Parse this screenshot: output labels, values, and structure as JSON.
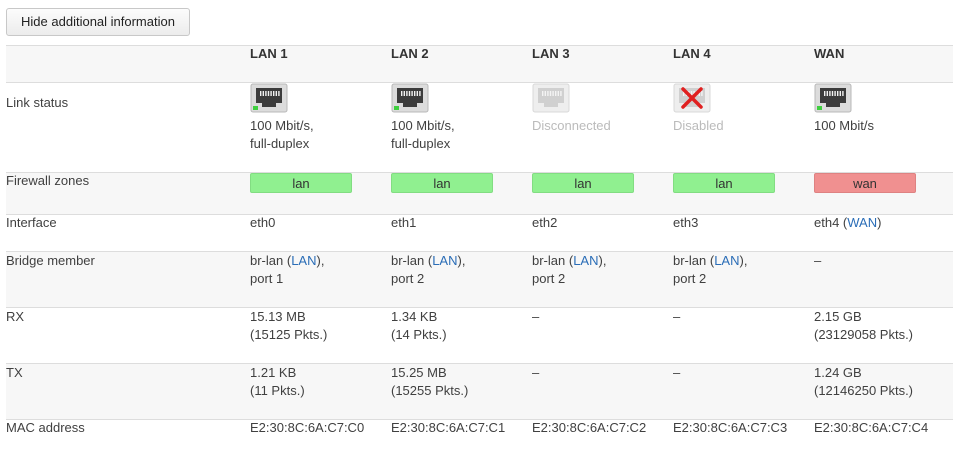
{
  "toggle_label": "Hide additional information",
  "ports": [
    {
      "name": "LAN 1",
      "link_state": "up",
      "link_line1": "100 Mbit/s,",
      "link_line2": "full-duplex",
      "zone": "lan",
      "iface": "eth0",
      "iface_suffix_pre": "",
      "iface_link": "",
      "iface_suffix_post": "",
      "bridge_pre": "br-lan (",
      "bridge_link": "LAN",
      "bridge_post": "),",
      "bridge_port": "port 1",
      "rx_1": "15.13 MB",
      "rx_2": "(15125 Pkts.)",
      "tx_1": "1.21 KB",
      "tx_2": "(11 Pkts.)",
      "mac": "E2:30:8C:6A:C7:C0"
    },
    {
      "name": "LAN 2",
      "link_state": "up",
      "link_line1": "100 Mbit/s,",
      "link_line2": "full-duplex",
      "zone": "lan",
      "iface": "eth1",
      "iface_suffix_pre": "",
      "iface_link": "",
      "iface_suffix_post": "",
      "bridge_pre": "br-lan (",
      "bridge_link": "LAN",
      "bridge_post": "),",
      "bridge_port": "port 2",
      "rx_1": "1.34 KB",
      "rx_2": "(14 Pkts.)",
      "tx_1": "15.25 MB",
      "tx_2": "(15255 Pkts.)",
      "mac": "E2:30:8C:6A:C7:C1"
    },
    {
      "name": "LAN 3",
      "link_state": "down",
      "link_line1": "Disconnected",
      "link_line2": "",
      "zone": "lan",
      "iface": "eth2",
      "iface_suffix_pre": "",
      "iface_link": "",
      "iface_suffix_post": "",
      "bridge_pre": "br-lan (",
      "bridge_link": "LAN",
      "bridge_post": "),",
      "bridge_port": "port 2",
      "rx_1": "–",
      "rx_2": "",
      "tx_1": "–",
      "tx_2": "",
      "mac": "E2:30:8C:6A:C7:C2"
    },
    {
      "name": "LAN 4",
      "link_state": "disabled",
      "link_line1": "Disabled",
      "link_line2": "",
      "zone": "lan",
      "iface": "eth3",
      "iface_suffix_pre": "",
      "iface_link": "",
      "iface_suffix_post": "",
      "bridge_pre": "br-lan (",
      "bridge_link": "LAN",
      "bridge_post": "),",
      "bridge_port": "port 2",
      "rx_1": "–",
      "rx_2": "",
      "tx_1": "–",
      "tx_2": "",
      "mac": "E2:30:8C:6A:C7:C3"
    },
    {
      "name": "WAN",
      "link_state": "up",
      "link_line1": "100 Mbit/s",
      "link_line2": "",
      "zone": "wan",
      "iface": "eth4",
      "iface_suffix_pre": " (",
      "iface_link": "WAN",
      "iface_suffix_post": ")",
      "bridge_pre": "–",
      "bridge_link": "",
      "bridge_post": "",
      "bridge_port": "",
      "rx_1": "2.15 GB",
      "rx_2": "(23129058 Pkts.)",
      "tx_1": "1.24 GB",
      "tx_2": "(12146250 Pkts.)",
      "mac": "E2:30:8C:6A:C7:C4"
    }
  ],
  "row_labels": {
    "link_status": "Link status",
    "firewall_zones": "Firewall zones",
    "interface": "Interface",
    "bridge_member": "Bridge member",
    "rx": "RX",
    "tx": "TX",
    "mac_address": "MAC address"
  },
  "colors": {
    "zone_lan": "#90f090",
    "zone_wan": "#f09090",
    "link": "#2a6db7",
    "muted": "#bbbbbb"
  }
}
